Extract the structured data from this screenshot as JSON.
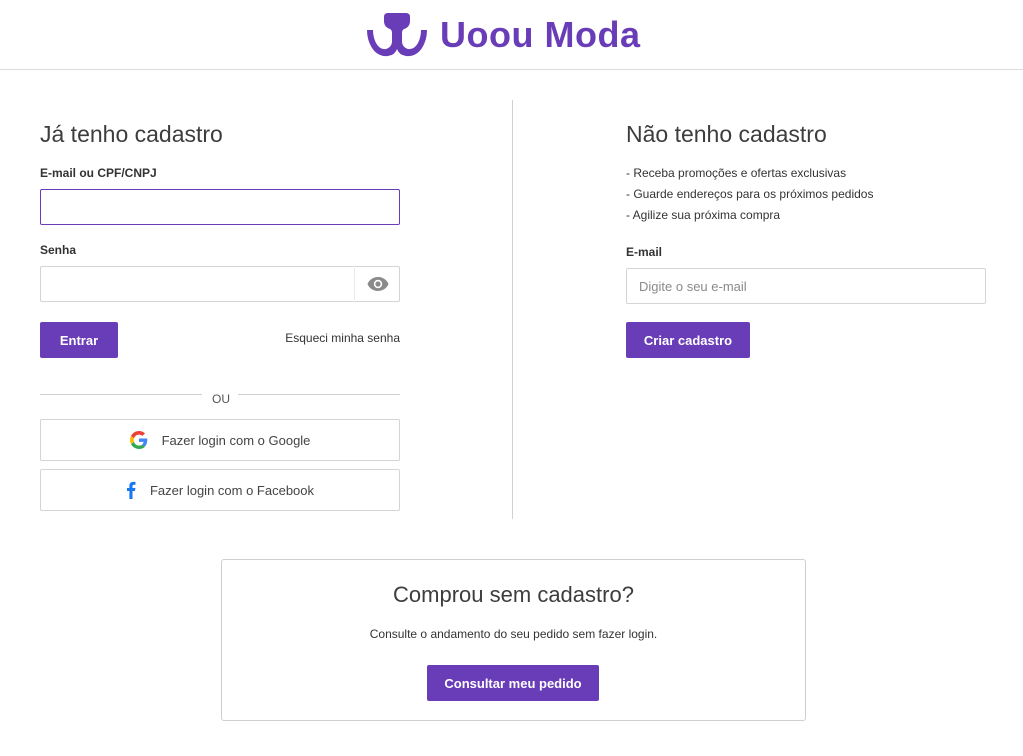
{
  "header": {
    "brand_name": "Uoou Moda",
    "brand_color": "#6a3db8"
  },
  "login": {
    "title": "Já tenho cadastro",
    "email_label": "E-mail ou CPF/CNPJ",
    "email_value": "",
    "password_label": "Senha",
    "password_value": "",
    "password_toggle_icon": "eye-icon",
    "submit_label": "Entrar",
    "forgot_label": "Esqueci minha senha",
    "or_label": "OU",
    "google_label": "Fazer login com o Google",
    "google_icon": "google-icon",
    "facebook_label": "Fazer login com o Facebook",
    "facebook_icon": "facebook-icon"
  },
  "register": {
    "title": "Não tenho cadastro",
    "benefits": [
      "- Receba promoções e ofertas exclusivas",
      "- Guarde endereços para os próximos pedidos",
      "- Agilize sua próxima compra"
    ],
    "email_label": "E-mail",
    "email_placeholder": "Digite o seu e-mail",
    "submit_label": "Criar cadastro"
  },
  "guest": {
    "title": "Comprou sem cadastro?",
    "description": "Consulte o andamento do seu pedido sem fazer login.",
    "button_label": "Consultar meu pedido"
  }
}
